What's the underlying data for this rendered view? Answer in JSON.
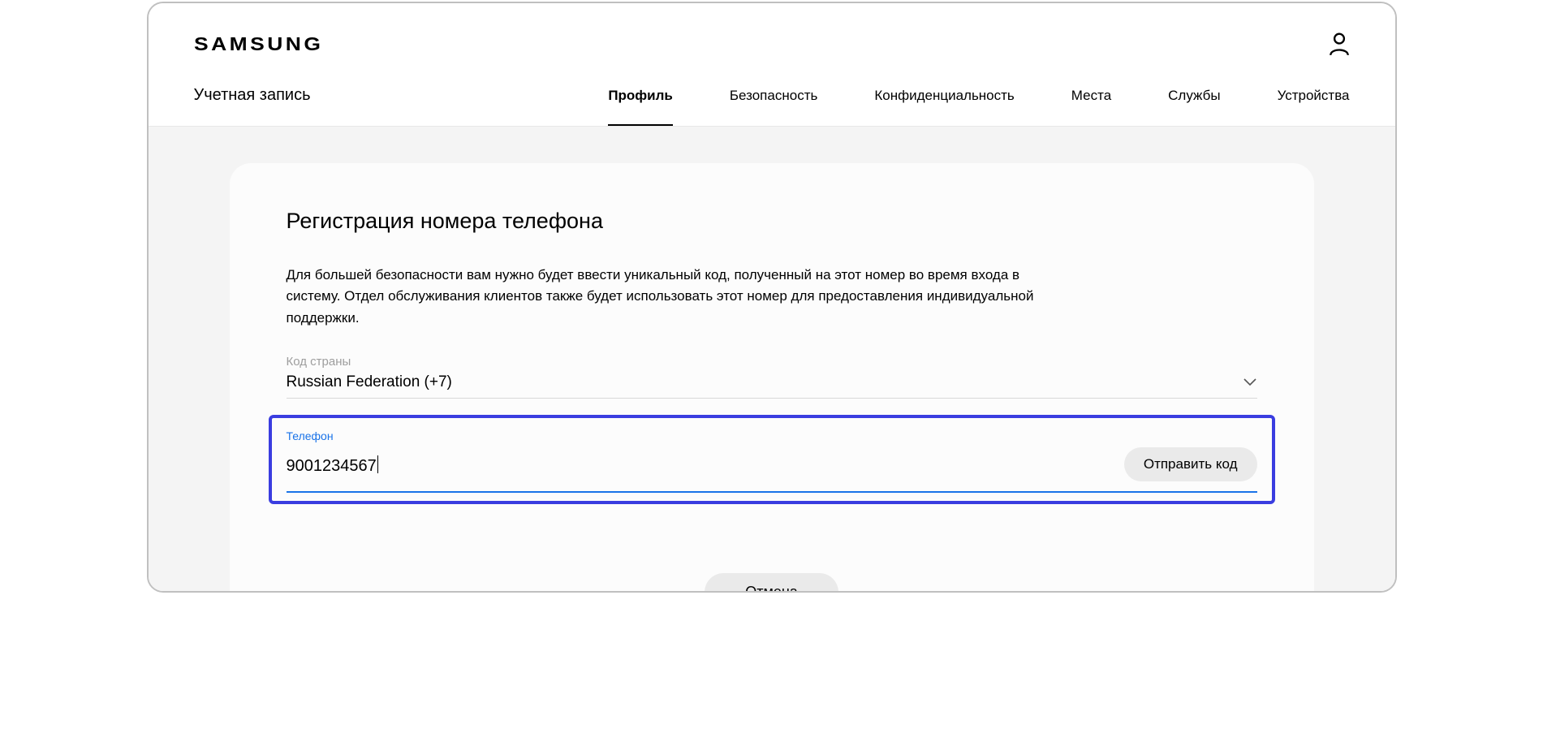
{
  "header": {
    "logo_text": "SAMSUNG"
  },
  "nav": {
    "account_label": "Учетная запись",
    "tabs": {
      "profile": "Профиль",
      "security": "Безопасность",
      "privacy": "Конфиденциальность",
      "places": "Места",
      "services": "Службы",
      "devices": "Устройства"
    }
  },
  "card": {
    "title": "Регистрация номера телефона",
    "description": "Для большей безопасности вам нужно будет ввести уникальный код, полученный на этот номер во время входа в систему. Отдел обслуживания клиентов также будет использовать этот номер для предоставления индивидуальной поддержки.",
    "country_label": "Код страны",
    "country_value": "Russian Federation (+7)",
    "phone_label": "Телефон",
    "phone_value": "9001234567",
    "send_code_label": "Отправить код",
    "cancel_label": "Отмена"
  }
}
